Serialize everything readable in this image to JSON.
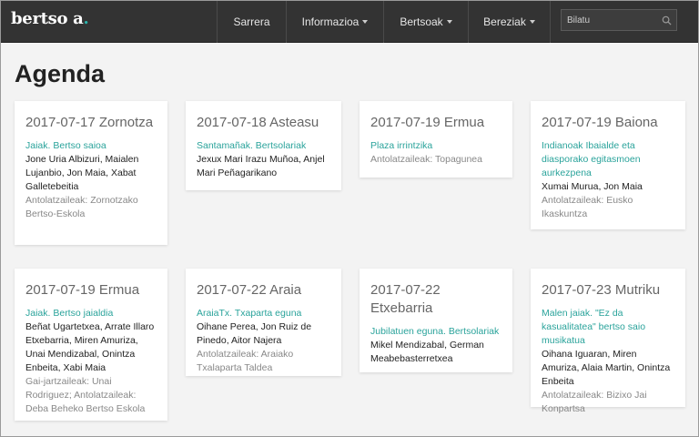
{
  "header": {
    "logo_text": "bertso a",
    "logo_dot": ".",
    "nav": [
      {
        "label": "Sarrera",
        "dropdown": false
      },
      {
        "label": "Informazioa",
        "dropdown": true
      },
      {
        "label": "Bertsoak",
        "dropdown": true
      },
      {
        "label": "Bereziak",
        "dropdown": true
      }
    ],
    "search_placeholder": "Bilatu",
    "search_icon": "search-icon"
  },
  "page": {
    "title": "Agenda"
  },
  "colors": {
    "accent": "#2aa39b",
    "header_bg": "#333333",
    "page_bg": "#f3f3f3"
  },
  "events": [
    {
      "date": "2017-07-17 Zornotza",
      "title": "Jaiak. Bertso saioa",
      "people": "Jone Uria Albizuri, Maialen Lujanbio, Jon Maia, Xabat Galletebeitia",
      "organizers": "Antolatzaileak: Zornotzako Bertso-Eskola"
    },
    {
      "date": "2017-07-18 Asteasu",
      "title": "Santamañak. Bertsolariak",
      "people": "Jexux Mari Irazu Muñoa, Anjel Mari Peñagarikano",
      "organizers": ""
    },
    {
      "date": "2017-07-19 Ermua",
      "title": "Plaza irrintzika",
      "people": "",
      "organizers": "Antolatzaileak: Topagunea"
    },
    {
      "date": "2017-07-19 Baiona",
      "title": "Indianoak Ibaialde eta diasporako egitasmoen aurkezpena",
      "people": "Xumai Murua, Jon Maia",
      "organizers": "Antolatzaileak: Eusko Ikaskuntza"
    },
    {
      "date": "2017-07-19 Ermua",
      "title": "Jaiak. Bertso jaialdia",
      "people": "Beñat Ugartetxea, Arrate Illaro Etxebarria, Miren Amuriza, Unai Mendizabal, Onintza Enbeita, Xabi Maia",
      "organizers": "Gai-jartzaileak: Unai Rodriguez; Antolatzaileak: Deba Beheko Bertso Eskola"
    },
    {
      "date": "2017-07-22 Araia",
      "title": "AraiaTx. Txaparta eguna",
      "people": "Oihane Perea, Jon Ruiz de Pinedo, Aitor Najera",
      "organizers": "Antolatzaileak: Araiako Txalaparta Taldea"
    },
    {
      "date": "2017-07-22 Etxebarria",
      "title": "Jubilatuen eguna. Bertsolariak",
      "people": "Mikel Mendizabal, German Meabebasterretxea",
      "organizers": ""
    },
    {
      "date": "2017-07-23 Mutriku",
      "title": "Malen jaiak. \"Ez da kasualitatea\" bertso saio musikatua",
      "people": "Oihana Iguaran, Miren Amuriza, Alaia Martin, Onintza Enbeita",
      "organizers": "Antolatzaileak: Bizixo Jai Konpartsa"
    }
  ]
}
